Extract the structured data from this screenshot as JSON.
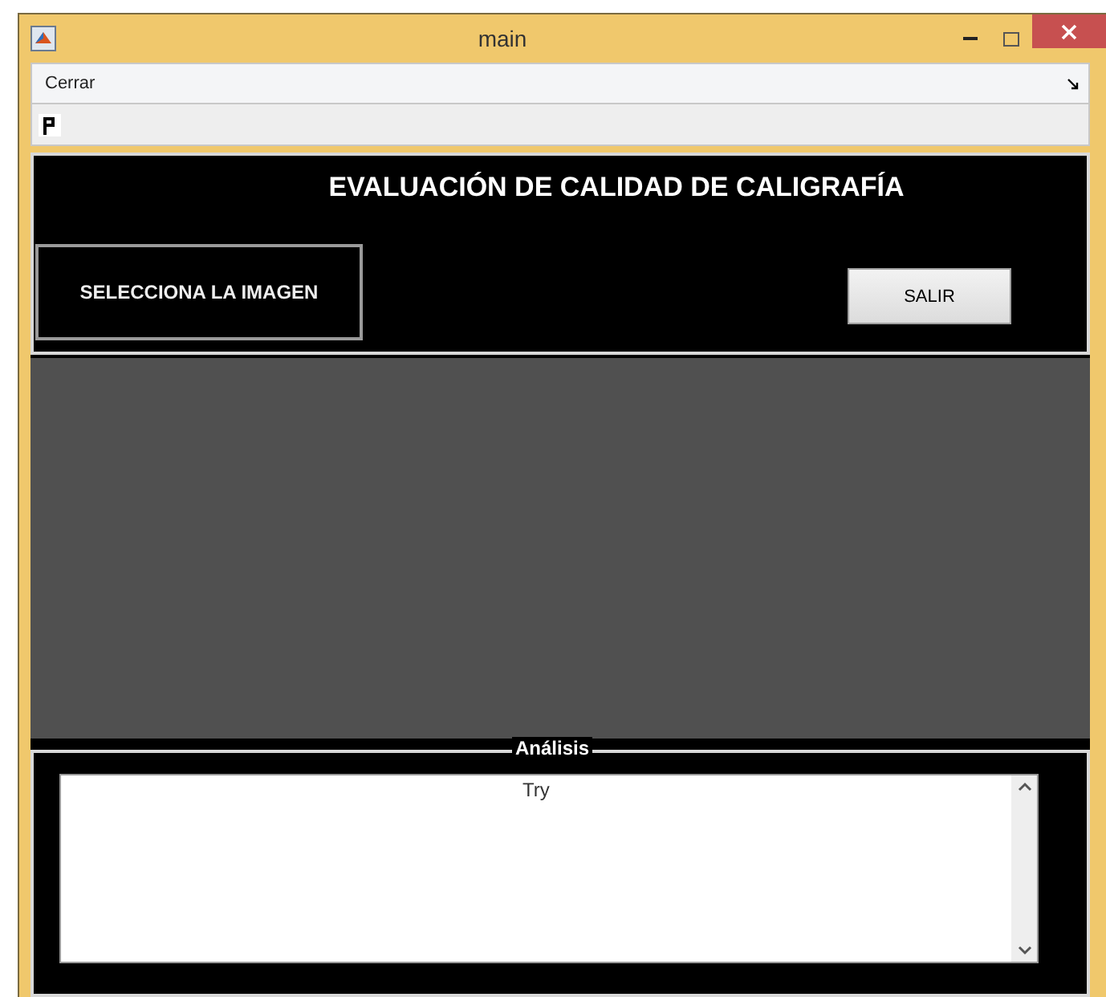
{
  "window": {
    "title": "main"
  },
  "menu": [
    {
      "label": "Cerrar"
    }
  ],
  "header": {
    "title": "EVALUACIÓN DE CALIDAD DE CALIGRAFÍA",
    "select_button": "SELECCIONA LA IMAGEN",
    "exit_button": "SALIR"
  },
  "analysis": {
    "title": "Análisis",
    "text": "Try"
  }
}
